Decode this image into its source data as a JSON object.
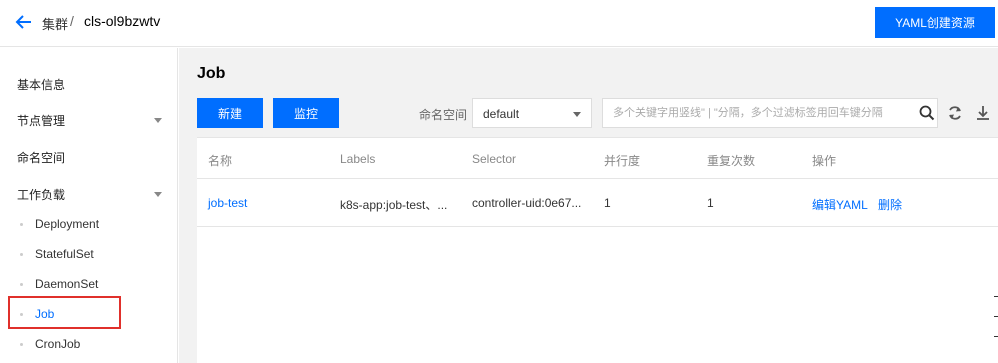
{
  "header": {
    "breadcrumb_root": "集群",
    "breadcrumb_separator": "/",
    "cluster_id": "cls-ol9bzwtv",
    "yaml_create_label": "YAML创建资源"
  },
  "sidebar": {
    "items": [
      {
        "label": "基本信息"
      },
      {
        "label": "节点管理"
      },
      {
        "label": "命名空间"
      },
      {
        "label": "工作负载"
      }
    ],
    "workload_subitems": [
      {
        "label": "Deployment"
      },
      {
        "label": "StatefulSet"
      },
      {
        "label": "DaemonSet"
      },
      {
        "label": "Job"
      },
      {
        "label": "CronJob"
      }
    ]
  },
  "main": {
    "title": "Job",
    "new_button": "新建",
    "monitor_button": "监控",
    "namespace_label": "命名空间",
    "namespace_value": "default",
    "search_placeholder": "多个关键字用竖线\" | \"分隔，多个过滤标签用回车键分隔"
  },
  "table": {
    "columns": [
      "名称",
      "Labels",
      "Selector",
      "并行度",
      "重复次数",
      "操作"
    ],
    "rows": [
      {
        "name": "job-test",
        "labels": "k8s-app:job-test、...",
        "selector": "controller-uid:0e67...",
        "parallelism": "1",
        "completions": "1",
        "action_edit": "编辑YAML",
        "action_delete": "删除"
      }
    ]
  },
  "colors": {
    "primary": "#006eff",
    "highlight_border": "#e0302b"
  }
}
